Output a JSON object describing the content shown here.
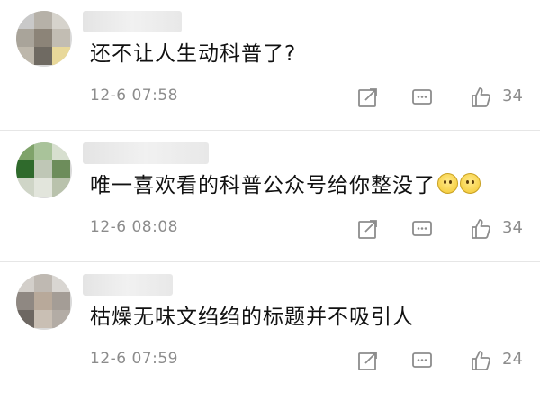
{
  "comments": [
    {
      "text": "还不让人生动科普了?",
      "time": "12-6 07:58",
      "likes": "34",
      "emoji_count": 0
    },
    {
      "text": "唯一喜欢看的科普公众号给你整没了",
      "time": "12-6 08:08",
      "likes": "34",
      "emoji_count": 2,
      "emoji_icon": "sweat-smile-emoji-icon"
    },
    {
      "text": "枯燥无味文绉绉的标题并不吸引人",
      "time": "12-6 07:59",
      "likes": "24",
      "emoji_count": 0
    }
  ],
  "icons": {
    "share": "share-icon",
    "reply": "comment-icon",
    "like": "thumbs-up-icon"
  },
  "colors": {
    "meta_gray": "#8c8c8c",
    "text": "#111111",
    "divider": "#e6e6e6"
  }
}
